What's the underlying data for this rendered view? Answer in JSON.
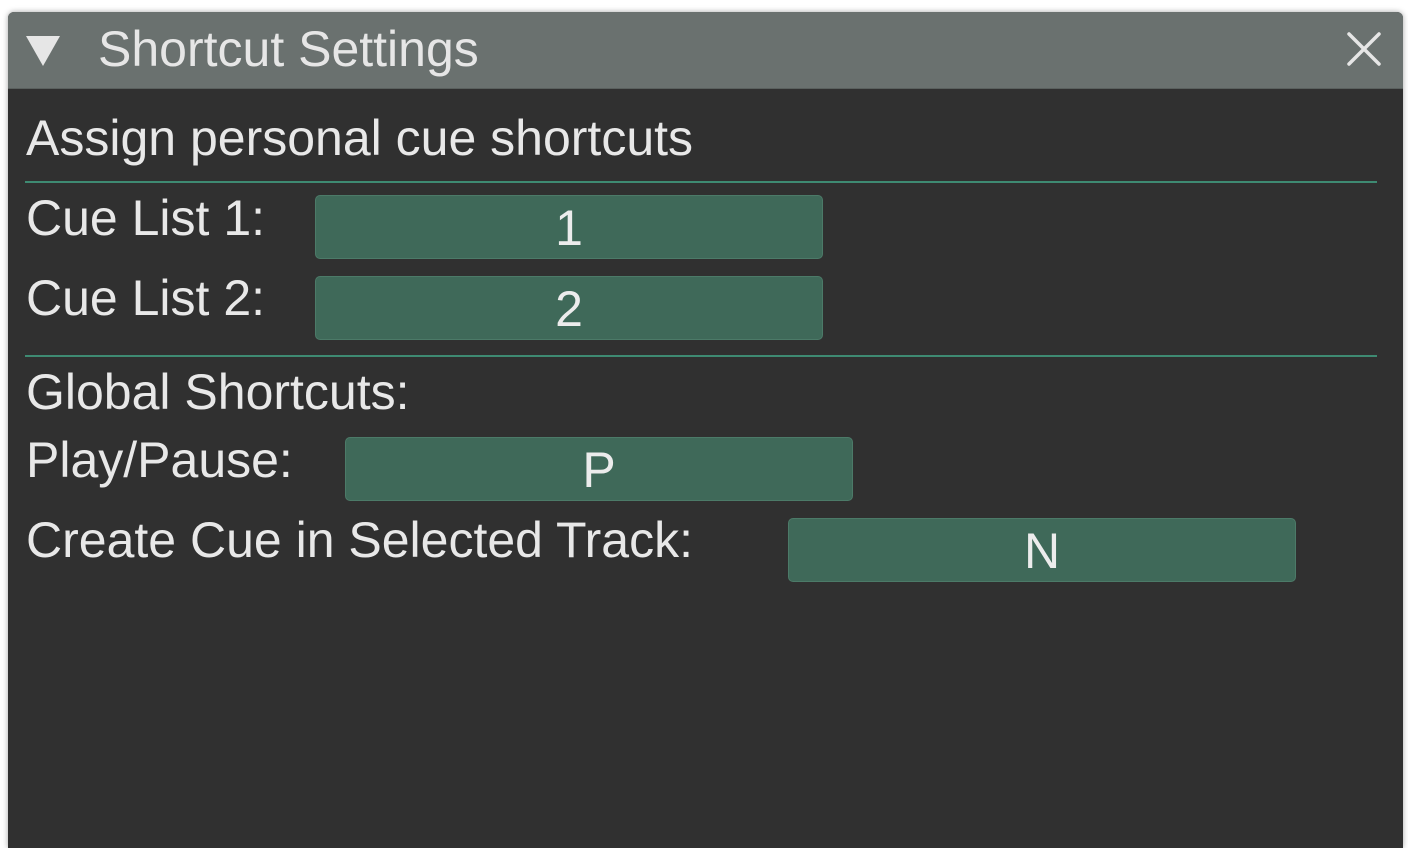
{
  "window": {
    "title": "Shortcut Settings",
    "collapse_icon": "triangle-down-icon",
    "close_icon": "close-icon"
  },
  "content": {
    "heading": "Assign personal cue shortcuts",
    "cue_lists": [
      {
        "label": "Cue List 1:",
        "key": "1"
      },
      {
        "label": "Cue List 2:",
        "key": "2"
      }
    ],
    "global_heading": "Global Shortcuts:",
    "global": [
      {
        "label": "Play/Pause:",
        "key": "P"
      },
      {
        "label": "Create Cue in Selected Track:",
        "key": "N"
      }
    ]
  },
  "colors": {
    "background": "#303030",
    "titlebar": "#6a716f",
    "separator": "#3e8a72",
    "key_field": "#3f6959",
    "text": "#e8e8e8"
  }
}
